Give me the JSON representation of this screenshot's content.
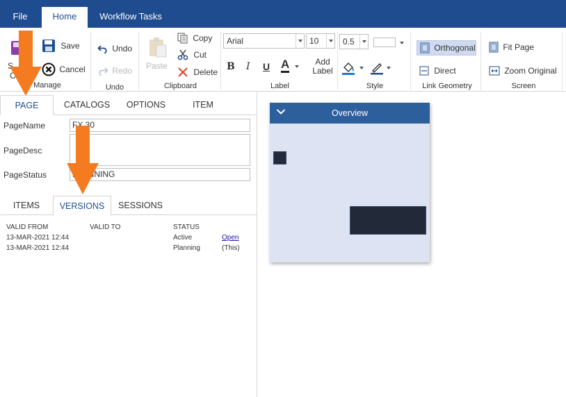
{
  "menu": {
    "file": "File",
    "home": "Home",
    "workflow": "Workflow Tasks"
  },
  "ribbon": {
    "manage": {
      "save_as_partial_top": "S",
      "save_as_partial_bottom": "C",
      "save": "Save",
      "cancel": "Cancel",
      "label": "Manage"
    },
    "undo": {
      "undo": "Undo",
      "redo": "Redo",
      "label": "Undo"
    },
    "clipboard": {
      "paste": "Paste",
      "copy": "Copy",
      "cut": "Cut",
      "delete": "Delete",
      "label": "Clipboard"
    },
    "label": {
      "font": "Arial",
      "size": "10",
      "bold": "B",
      "italic": "I",
      "underline": "U",
      "font_color_letter": "A",
      "add_label_1": "Add",
      "add_label_2": "Label",
      "label": "Label"
    },
    "style": {
      "line_width": "0.5",
      "label": "Style"
    },
    "link_geometry": {
      "orthogonal": "Orthogonal",
      "direct": "Direct",
      "label": "Link Geometry"
    },
    "screen": {
      "fit_page": "Fit Page",
      "zoom_original": "Zoom Original",
      "label": "Screen"
    }
  },
  "left_tabs": [
    "PAGE",
    "CATALOGS",
    "OPTIONS",
    "ITEM"
  ],
  "page_fields": {
    "name_label": "PageName",
    "name_value": "FX 30",
    "desc_label": "PageDesc",
    "desc_value": "",
    "status_label": "PageStatus",
    "status_value": "PLANNING"
  },
  "sub_tabs": [
    "ITEMS",
    "VERSIONS",
    "SESSIONS"
  ],
  "versions": {
    "headers": [
      "VALID FROM",
      "VALID TO",
      "STATUS"
    ],
    "rows": [
      {
        "valid_from": "13-MAR-2021 12:44",
        "valid_to": "",
        "status": "Active",
        "action": "Open"
      },
      {
        "valid_from": "13-MAR-2021 12:44",
        "valid_to": "",
        "status": "Planning",
        "action": "(This)"
      }
    ]
  },
  "overview": {
    "title": "Overview"
  },
  "colors": {
    "menubar": "#1e4c8f",
    "overview_header": "#2e5f9d",
    "overview_bg": "#dde3f2",
    "arrow": "#f47b20"
  }
}
